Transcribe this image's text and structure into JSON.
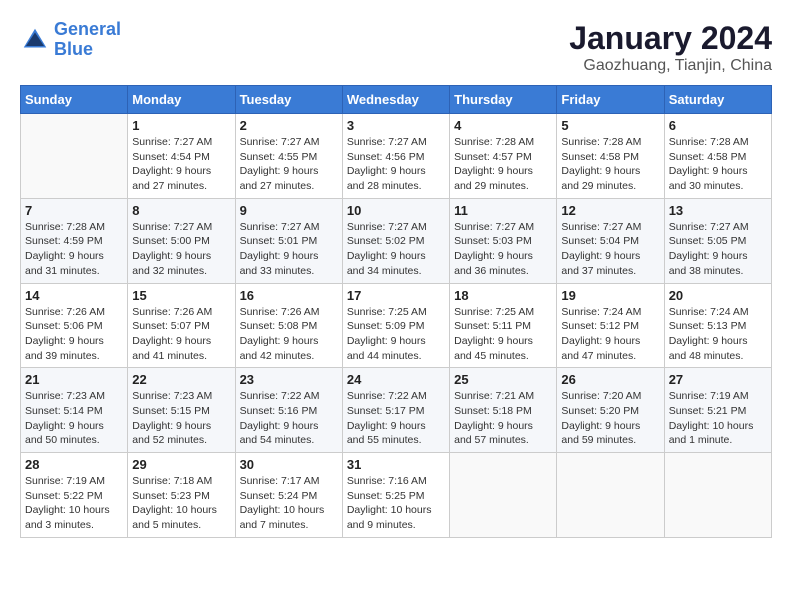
{
  "header": {
    "logo_line1": "General",
    "logo_line2": "Blue",
    "title": "January 2024",
    "subtitle": "Gaozhuang, Tianjin, China"
  },
  "calendar": {
    "columns": [
      "Sunday",
      "Monday",
      "Tuesday",
      "Wednesday",
      "Thursday",
      "Friday",
      "Saturday"
    ],
    "weeks": [
      [
        {
          "day": "",
          "info": ""
        },
        {
          "day": "1",
          "info": "Sunrise: 7:27 AM\nSunset: 4:54 PM\nDaylight: 9 hours\nand 27 minutes."
        },
        {
          "day": "2",
          "info": "Sunrise: 7:27 AM\nSunset: 4:55 PM\nDaylight: 9 hours\nand 27 minutes."
        },
        {
          "day": "3",
          "info": "Sunrise: 7:27 AM\nSunset: 4:56 PM\nDaylight: 9 hours\nand 28 minutes."
        },
        {
          "day": "4",
          "info": "Sunrise: 7:28 AM\nSunset: 4:57 PM\nDaylight: 9 hours\nand 29 minutes."
        },
        {
          "day": "5",
          "info": "Sunrise: 7:28 AM\nSunset: 4:58 PM\nDaylight: 9 hours\nand 29 minutes."
        },
        {
          "day": "6",
          "info": "Sunrise: 7:28 AM\nSunset: 4:58 PM\nDaylight: 9 hours\nand 30 minutes."
        }
      ],
      [
        {
          "day": "7",
          "info": "Sunrise: 7:28 AM\nSunset: 4:59 PM\nDaylight: 9 hours\nand 31 minutes."
        },
        {
          "day": "8",
          "info": "Sunrise: 7:27 AM\nSunset: 5:00 PM\nDaylight: 9 hours\nand 32 minutes."
        },
        {
          "day": "9",
          "info": "Sunrise: 7:27 AM\nSunset: 5:01 PM\nDaylight: 9 hours\nand 33 minutes."
        },
        {
          "day": "10",
          "info": "Sunrise: 7:27 AM\nSunset: 5:02 PM\nDaylight: 9 hours\nand 34 minutes."
        },
        {
          "day": "11",
          "info": "Sunrise: 7:27 AM\nSunset: 5:03 PM\nDaylight: 9 hours\nand 36 minutes."
        },
        {
          "day": "12",
          "info": "Sunrise: 7:27 AM\nSunset: 5:04 PM\nDaylight: 9 hours\nand 37 minutes."
        },
        {
          "day": "13",
          "info": "Sunrise: 7:27 AM\nSunset: 5:05 PM\nDaylight: 9 hours\nand 38 minutes."
        }
      ],
      [
        {
          "day": "14",
          "info": "Sunrise: 7:26 AM\nSunset: 5:06 PM\nDaylight: 9 hours\nand 39 minutes."
        },
        {
          "day": "15",
          "info": "Sunrise: 7:26 AM\nSunset: 5:07 PM\nDaylight: 9 hours\nand 41 minutes."
        },
        {
          "day": "16",
          "info": "Sunrise: 7:26 AM\nSunset: 5:08 PM\nDaylight: 9 hours\nand 42 minutes."
        },
        {
          "day": "17",
          "info": "Sunrise: 7:25 AM\nSunset: 5:09 PM\nDaylight: 9 hours\nand 44 minutes."
        },
        {
          "day": "18",
          "info": "Sunrise: 7:25 AM\nSunset: 5:11 PM\nDaylight: 9 hours\nand 45 minutes."
        },
        {
          "day": "19",
          "info": "Sunrise: 7:24 AM\nSunset: 5:12 PM\nDaylight: 9 hours\nand 47 minutes."
        },
        {
          "day": "20",
          "info": "Sunrise: 7:24 AM\nSunset: 5:13 PM\nDaylight: 9 hours\nand 48 minutes."
        }
      ],
      [
        {
          "day": "21",
          "info": "Sunrise: 7:23 AM\nSunset: 5:14 PM\nDaylight: 9 hours\nand 50 minutes."
        },
        {
          "day": "22",
          "info": "Sunrise: 7:23 AM\nSunset: 5:15 PM\nDaylight: 9 hours\nand 52 minutes."
        },
        {
          "day": "23",
          "info": "Sunrise: 7:22 AM\nSunset: 5:16 PM\nDaylight: 9 hours\nand 54 minutes."
        },
        {
          "day": "24",
          "info": "Sunrise: 7:22 AM\nSunset: 5:17 PM\nDaylight: 9 hours\nand 55 minutes."
        },
        {
          "day": "25",
          "info": "Sunrise: 7:21 AM\nSunset: 5:18 PM\nDaylight: 9 hours\nand 57 minutes."
        },
        {
          "day": "26",
          "info": "Sunrise: 7:20 AM\nSunset: 5:20 PM\nDaylight: 9 hours\nand 59 minutes."
        },
        {
          "day": "27",
          "info": "Sunrise: 7:19 AM\nSunset: 5:21 PM\nDaylight: 10 hours\nand 1 minute."
        }
      ],
      [
        {
          "day": "28",
          "info": "Sunrise: 7:19 AM\nSunset: 5:22 PM\nDaylight: 10 hours\nand 3 minutes."
        },
        {
          "day": "29",
          "info": "Sunrise: 7:18 AM\nSunset: 5:23 PM\nDaylight: 10 hours\nand 5 minutes."
        },
        {
          "day": "30",
          "info": "Sunrise: 7:17 AM\nSunset: 5:24 PM\nDaylight: 10 hours\nand 7 minutes."
        },
        {
          "day": "31",
          "info": "Sunrise: 7:16 AM\nSunset: 5:25 PM\nDaylight: 10 hours\nand 9 minutes."
        },
        {
          "day": "",
          "info": ""
        },
        {
          "day": "",
          "info": ""
        },
        {
          "day": "",
          "info": ""
        }
      ]
    ]
  }
}
